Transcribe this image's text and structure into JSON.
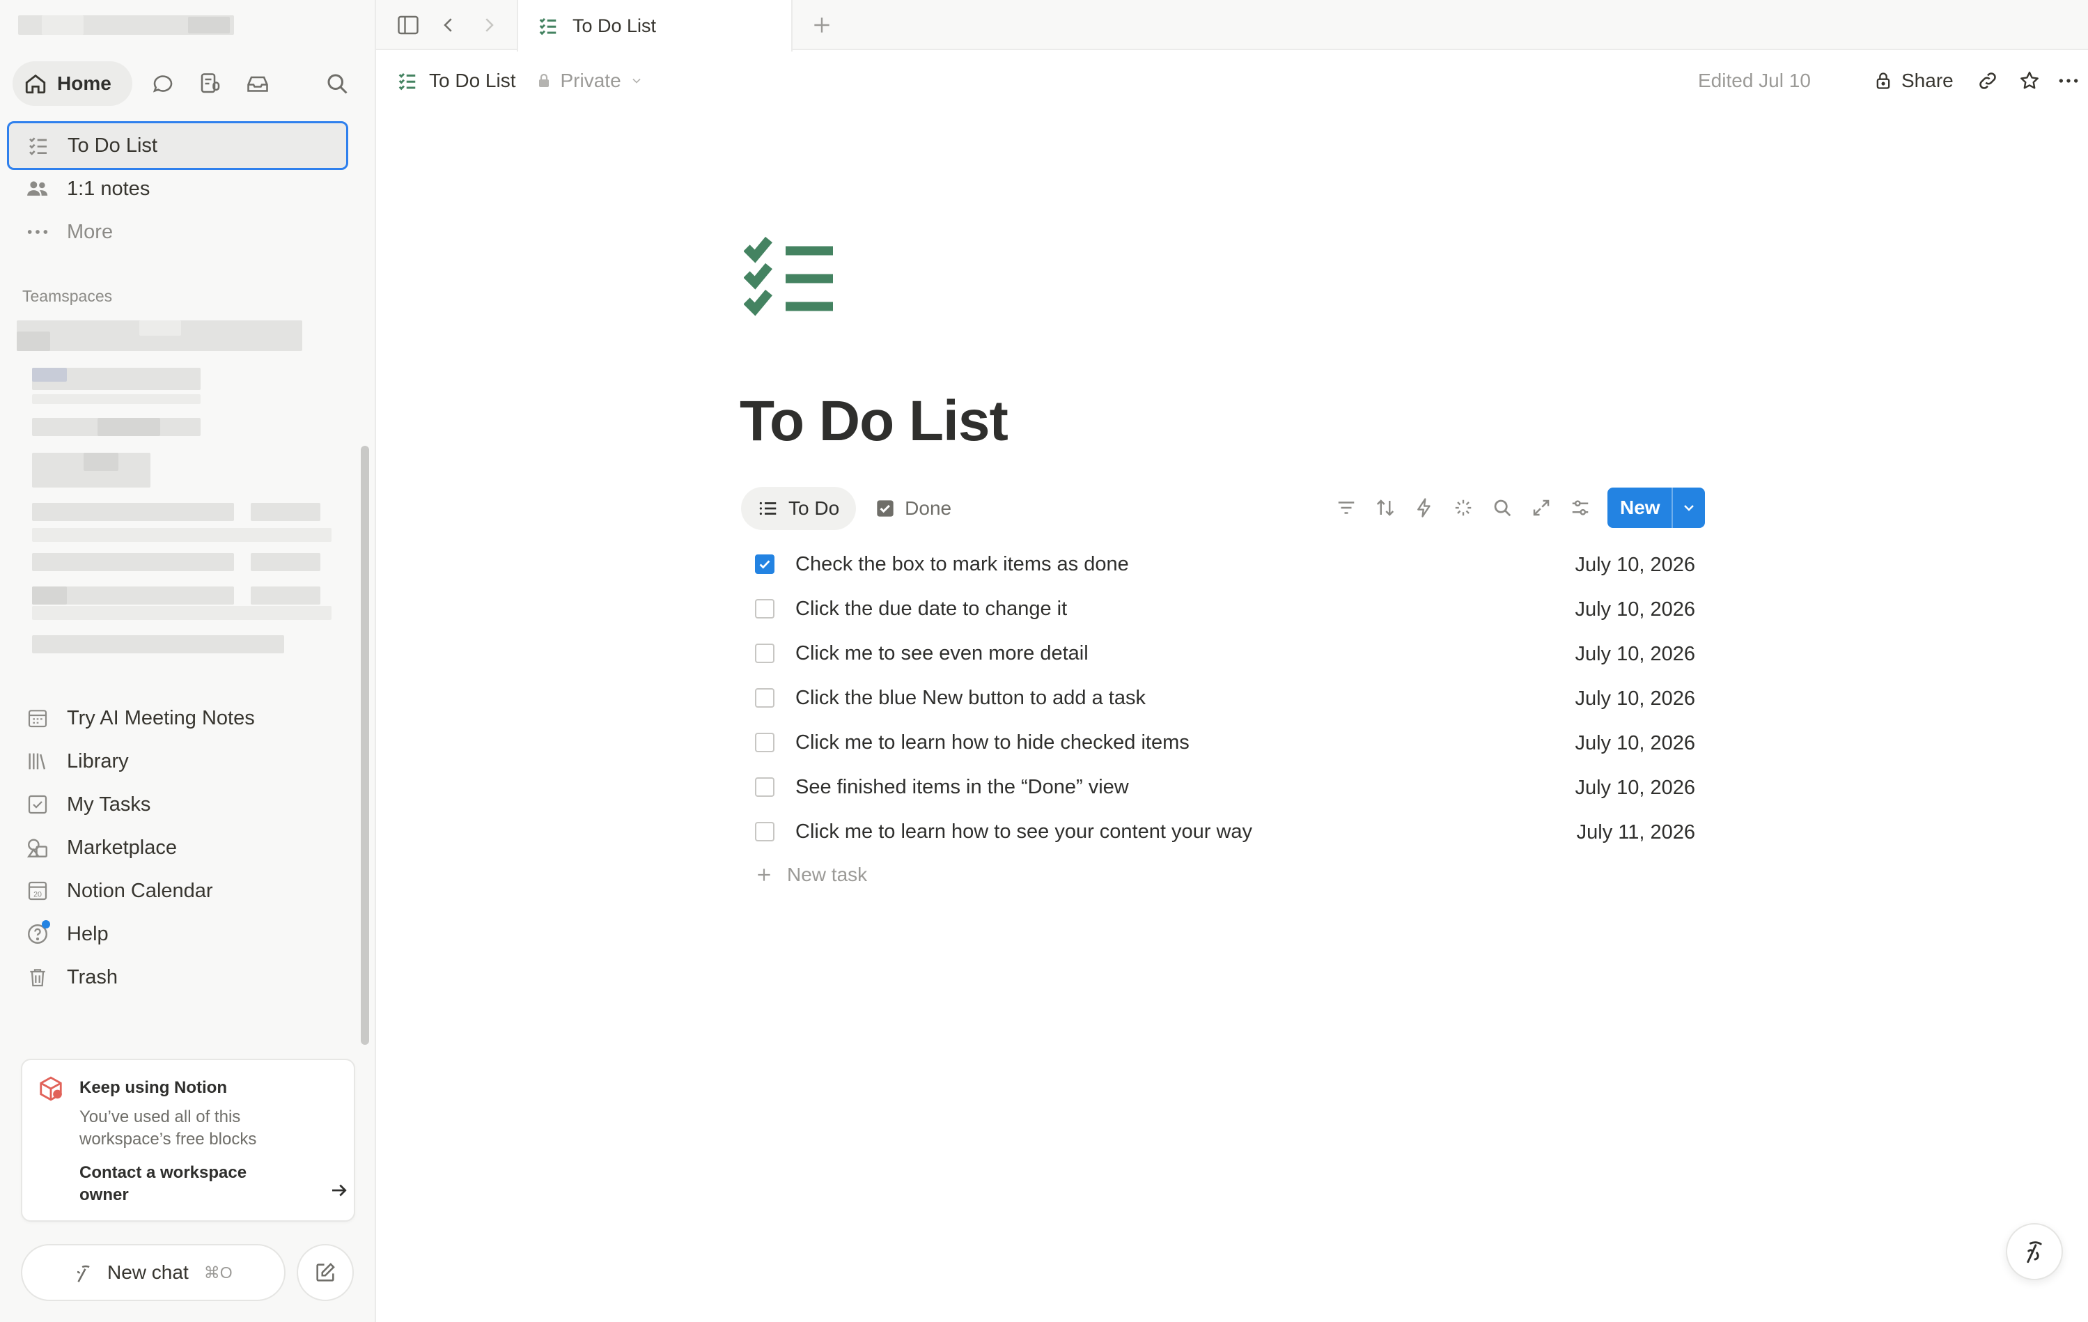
{
  "sidebar": {
    "home_label": "Home",
    "icons": [
      "chat-icon",
      "meeting-notes-icon",
      "inbox-icon",
      "search-icon"
    ],
    "items": [
      {
        "label": "To Do List",
        "icon": "checklist-icon"
      },
      {
        "label": "1:1 notes",
        "icon": "people-icon"
      },
      {
        "label": "More",
        "icon": "more-dots-icon"
      }
    ],
    "teamspaces_label": "Teamspaces",
    "bottom_items": [
      {
        "label": "Try AI Meeting Notes",
        "icon": "calendar-grid-icon"
      },
      {
        "label": "Library",
        "icon": "library-icon"
      },
      {
        "label": "My Tasks",
        "icon": "checkbox-icon"
      },
      {
        "label": "Marketplace",
        "icon": "marketplace-icon"
      },
      {
        "label": "Notion Calendar",
        "icon": "calendar-icon"
      },
      {
        "label": "Help",
        "icon": "help-icon"
      },
      {
        "label": "Trash",
        "icon": "trash-icon"
      }
    ],
    "calendar_day": "20",
    "keep_card": {
      "title": "Keep using Notion",
      "body": "You’ve used all of this workspace’s free blocks",
      "link": "Contact a workspace owner"
    },
    "new_chat": {
      "label": "New chat",
      "shortcut": "⌘O"
    }
  },
  "tabbar": {
    "active_tab": "To Do List"
  },
  "header": {
    "breadcrumb_title": "To Do List",
    "privacy": "Private",
    "edited": "Edited Jul 10",
    "share": "Share"
  },
  "page": {
    "title": "To Do List",
    "icon_color": "#448361",
    "views": [
      {
        "label": "To Do",
        "active": true
      },
      {
        "label": "Done",
        "active": false
      }
    ],
    "toolbar_icons": [
      "filter-icon",
      "sort-icon",
      "automation-icon",
      "ai-sparkle-icon",
      "search-icon",
      "expand-icon",
      "settings-icon"
    ],
    "new_button": "New",
    "tasks": [
      {
        "title": "Check the box to mark items as done",
        "date": "July 10, 2026",
        "checked": true
      },
      {
        "title": "Click the due date to change it",
        "date": "July 10, 2026",
        "checked": false
      },
      {
        "title": "Click me to see even more detail",
        "date": "July 10, 2026",
        "checked": false
      },
      {
        "title": "Click the blue New button to add a task",
        "date": "July 10, 2026",
        "checked": false
      },
      {
        "title": "Click me to learn how to hide checked items",
        "date": "July 10, 2026",
        "checked": false
      },
      {
        "title": "See finished items in the “Done” view",
        "date": "July 10, 2026",
        "checked": false
      },
      {
        "title": "Click me to learn how to see your content your way",
        "date": "July 11, 2026",
        "checked": false
      }
    ],
    "new_task_label": "New task"
  },
  "colors": {
    "accent": "#2383e2",
    "brand_green": "#448361",
    "sidebar_bg": "#f8f8f7"
  }
}
